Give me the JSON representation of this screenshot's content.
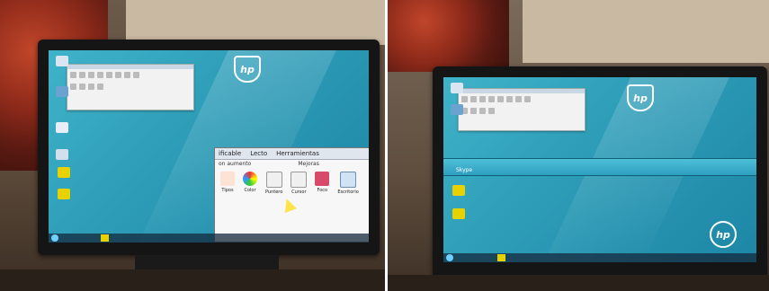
{
  "photos": [
    {
      "id": "left",
      "zoom_window": {
        "tabs": [
          "ificable",
          "Lecto",
          "Herramientas"
        ],
        "subheader_left": "on aumento",
        "subheader_mid": "Mejoras",
        "tools": [
          "Tipos",
          "Color",
          "Puntero",
          "Cursor",
          "Foco",
          "Escritorio"
        ]
      }
    },
    {
      "id": "right",
      "strip_label": "Skype"
    }
  ],
  "colors": {
    "screen": "#2d9cb7",
    "bezel": "#151515",
    "cursor": "#ffe34a"
  },
  "icons": [
    "hp-logo",
    "desktop-icon",
    "arrow-cursor",
    "windows-start"
  ]
}
